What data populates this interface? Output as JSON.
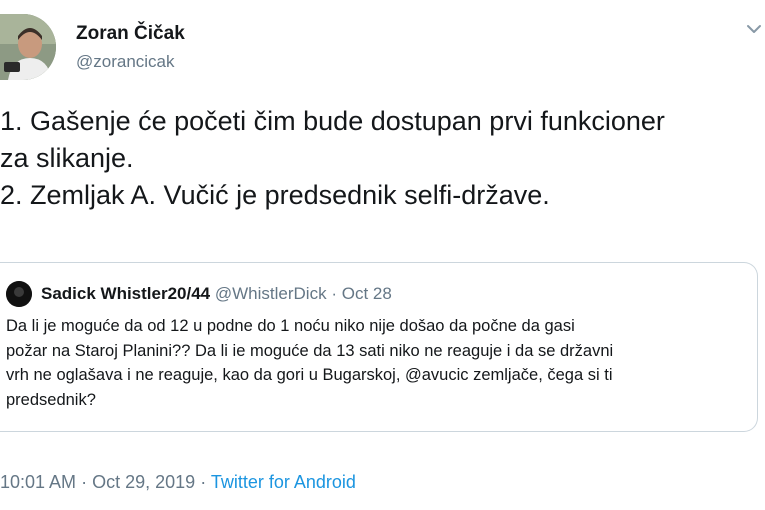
{
  "author": {
    "name": "Zoran Čičak",
    "handle": "@zorancicak",
    "avatar_icon": "profile-photo-icon"
  },
  "tweet": {
    "lines": [
      "1. Gašenje će početi čim bude dostupan prvi funkcioner",
      "za slikanje.",
      "2. Zemljak A. Vučić je predsednik selfi-države."
    ]
  },
  "quoted_tweet": {
    "name": "Sadick Whistler20/44",
    "handle": "@WhistlerDick",
    "separator": "·",
    "date": "Oct 28",
    "lines": [
      "Da li je moguće da od 12 u podne do 1 noću niko nije došao da počne da gasi",
      "požar na Staroj Planini?? Da li ie moguće da 13 sati niko ne reaguje i da se državni",
      "vrh ne oglašava i ne reaguje, kao da gori u Bugarskoj, @avucic zemljače, čega si ti",
      "predsednik?"
    ]
  },
  "footer": {
    "time": "10:01 AM",
    "separator": "·",
    "date": "Oct 29, 2019",
    "source": "Twitter for Android"
  },
  "colors": {
    "text": "#14171a",
    "secondary": "#657786",
    "link": "#1b95e0",
    "border": "#ccd6dd"
  }
}
